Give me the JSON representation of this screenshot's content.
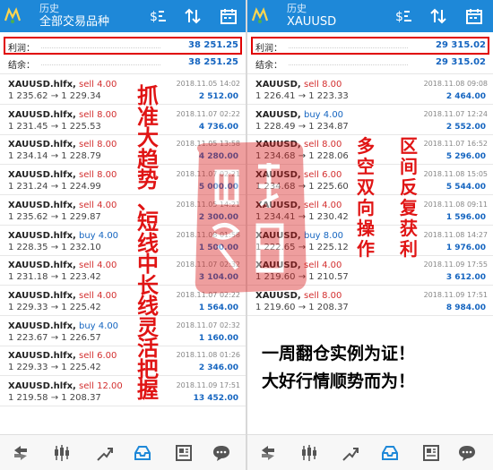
{
  "left": {
    "header": {
      "subtitle": "历史",
      "title": "全部交易品种"
    },
    "profit": {
      "label": "利润：",
      "value": "38 251.25"
    },
    "balance": {
      "label": "结余：",
      "value": "38 251.25"
    },
    "trades": [
      {
        "symbol": "XAUUSD.hlfx,",
        "action": "sell 4.00",
        "side": "sell",
        "prices": "1 235.62 → 1 229.34",
        "date": "2018.11.05 14:02",
        "profit": "2 512.00"
      },
      {
        "symbol": "XAUUSD.hlfx,",
        "action": "sell 8.00",
        "side": "sell",
        "prices": "1 231.45 → 1 225.53",
        "date": "2018.11.07 02:22",
        "profit": "4 736.00"
      },
      {
        "symbol": "XAUUSD.hlfx,",
        "action": "sell 8.00",
        "side": "sell",
        "prices": "1 234.14 → 1 228.79",
        "date": "2018.11.05 13:58",
        "profit": "4 280.00"
      },
      {
        "symbol": "XAUUSD.hlfx,",
        "action": "sell 8.00",
        "side": "sell",
        "prices": "1 231.24 → 1 224.99",
        "date": "2018.11.07 02:21",
        "profit": "5 000.00"
      },
      {
        "symbol": "XAUUSD.hlfx,",
        "action": "sell 4.00",
        "side": "sell",
        "prices": "1 235.62 → 1 229.87",
        "date": "2018.11.05 14:21",
        "profit": "2 300.00"
      },
      {
        "symbol": "XAUUSD.hlfx,",
        "action": "buy 4.00",
        "side": "buy",
        "prices": "1 228.35 → 1 232.10",
        "date": "2018.11.08 01:58",
        "profit": "1 500.00"
      },
      {
        "symbol": "XAUUSD.hlfx,",
        "action": "sell 4.00",
        "side": "sell",
        "prices": "1 231.18 → 1 223.42",
        "date": "2018.11.07 02:32",
        "profit": "3 104.00"
      },
      {
        "symbol": "XAUUSD.hlfx,",
        "action": "sell 4.00",
        "side": "sell",
        "prices": "1 229.33 → 1 225.42",
        "date": "2018.11.07 02:22",
        "profit": "1 564.00"
      },
      {
        "symbol": "XAUUSD.hlfx,",
        "action": "buy 4.00",
        "side": "buy",
        "prices": "1 223.67 → 1 226.57",
        "date": "2018.11.07 02:32",
        "profit": "1 160.00"
      },
      {
        "symbol": "XAUUSD.hlfx,",
        "action": "sell 6.00",
        "side": "sell",
        "prices": "1 229.33 → 1 225.42",
        "date": "2018.11.08 01:26",
        "profit": "2 346.00"
      },
      {
        "symbol": "XAUUSD.hlfx,",
        "action": "sell 12.00",
        "side": "sell",
        "prices": "1 219.58 → 1 208.37",
        "date": "2018.11.09 17:51",
        "profit": "13 452.00"
      }
    ],
    "callout_chars": [
      "抓",
      "准",
      "大",
      "趋",
      "势",
      "、",
      "短",
      "线",
      "中",
      "长",
      "线",
      "灵",
      "活",
      "把",
      "握"
    ]
  },
  "right": {
    "header": {
      "subtitle": "历史",
      "title": "XAUUSD"
    },
    "profit": {
      "label": "利润：",
      "value": "29 315.02"
    },
    "balance": {
      "label": "结余：",
      "value": "29 315.02"
    },
    "trades": [
      {
        "symbol": "XAUUSD,",
        "action": "sell 8.00",
        "side": "sell",
        "prices": "1 226.41 → 1 223.33",
        "date": "2018.11.08 09:08",
        "profit": "2 464.00"
      },
      {
        "symbol": "XAUUSD,",
        "action": "buy 4.00",
        "side": "buy",
        "prices": "1 228.49 → 1 234.87",
        "date": "2018.11.07 12:24",
        "profit": "2 552.00"
      },
      {
        "symbol": "XAUUSD,",
        "action": "sell 8.00",
        "side": "sell",
        "prices": "1 234.68 → 1 228.06",
        "date": "2018.11.07 16:52",
        "profit": "5 296.00"
      },
      {
        "symbol": "XAUUSD,",
        "action": "sell 6.00",
        "side": "sell",
        "prices": "1 234.68 → 1 225.60",
        "date": "2018.11.08 15:05",
        "profit": "5 544.00"
      },
      {
        "symbol": "XAUUSD,",
        "action": "sell 4.00",
        "side": "sell",
        "prices": "1 234.41 → 1 230.42",
        "date": "2018.11.08 09:11",
        "profit": "1 596.00"
      },
      {
        "symbol": "XAUUSD,",
        "action": "buy 8.00",
        "side": "buy",
        "prices": "1 222.65 → 1 225.12",
        "date": "2018.11.08 14:27",
        "profit": "1 976.00"
      },
      {
        "symbol": "XAUUSD,",
        "action": "sell 4.00",
        "side": "sell",
        "prices": "1 219.60 → 1 210.57",
        "date": "2018.11.09 17:55",
        "profit": "3 612.00"
      },
      {
        "symbol": "XAUUSD,",
        "action": "sell 8.00",
        "side": "sell",
        "prices": "1 219.60 → 1 208.37",
        "date": "2018.11.09 17:51",
        "profit": "8 984.00"
      }
    ],
    "callout_col1": [
      "多",
      "空",
      "双",
      "向",
      "操",
      "作"
    ],
    "callout_col2": [
      "区",
      "间",
      "反",
      "复",
      "获",
      "利"
    ],
    "caption_line1": "一周翻仓实例为证！",
    "caption_line2": "大好行情顺势而为！"
  },
  "colors": {
    "header_bg": "#1e88d8",
    "sell": "#d32f2f",
    "buy": "#1565c0",
    "profit": "#1565c0",
    "highlight_box": "#e00000",
    "callout": "#e01414"
  },
  "icons": {
    "header": [
      "metatrader-logo-icon",
      "trade-filter-icon",
      "sort-icon",
      "calendar-icon"
    ],
    "bottom": [
      "quotes-icon",
      "chart-candles-icon",
      "trade-icon",
      "history-icon",
      "news-icon",
      "chat-icon"
    ]
  }
}
